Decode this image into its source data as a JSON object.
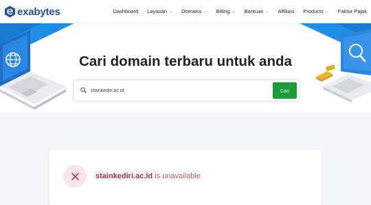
{
  "brand": {
    "name": "exabytes",
    "color": "#1e4fa0"
  },
  "nav": {
    "items": [
      {
        "label": "Dashboard",
        "has_dropdown": false
      },
      {
        "label": "Layanan",
        "has_dropdown": true
      },
      {
        "label": "Domains",
        "has_dropdown": true
      },
      {
        "label": "Billing",
        "has_dropdown": true
      },
      {
        "label": "Bantuan",
        "has_dropdown": true
      },
      {
        "label": "Affiliasi",
        "has_dropdown": false
      },
      {
        "label": "Products",
        "has_dropdown": true
      },
      {
        "label": "Faktur Pajak",
        "has_dropdown": false
      }
    ],
    "caret_icon": "chevron-down-icon"
  },
  "hero": {
    "title": "Cari domain terbaru untuk anda",
    "left_illustration": "laptop-globe-icon",
    "right_illustration": "laptop-search-icon"
  },
  "search": {
    "value": "stainkediri.ac.id",
    "icon": "search-icon",
    "button_label": "Cari",
    "button_color": "#1a9b36"
  },
  "result": {
    "domain": "stainkediri.ac.id",
    "status": " is unavailable",
    "icon": "close-icon",
    "color": "#b52a3c"
  }
}
